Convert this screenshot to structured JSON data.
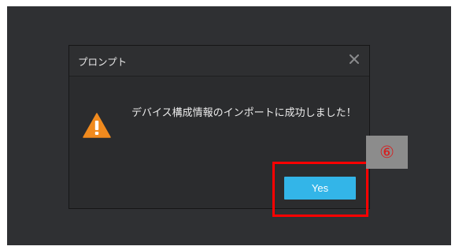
{
  "dialog": {
    "title": "プロンプト",
    "close_icon": "close-icon",
    "warning_icon": "warning-icon",
    "message": "デバイス構成情報のインポートに成功しました！",
    "yes_label": "Yes"
  },
  "annotation": {
    "step_number": "⑥",
    "highlight_color": "#ff0000"
  },
  "colors": {
    "background": "#2f3033",
    "dialog": "#2b2c2e",
    "accent_button": "#33b5e8",
    "warning": "#f08a1e"
  }
}
